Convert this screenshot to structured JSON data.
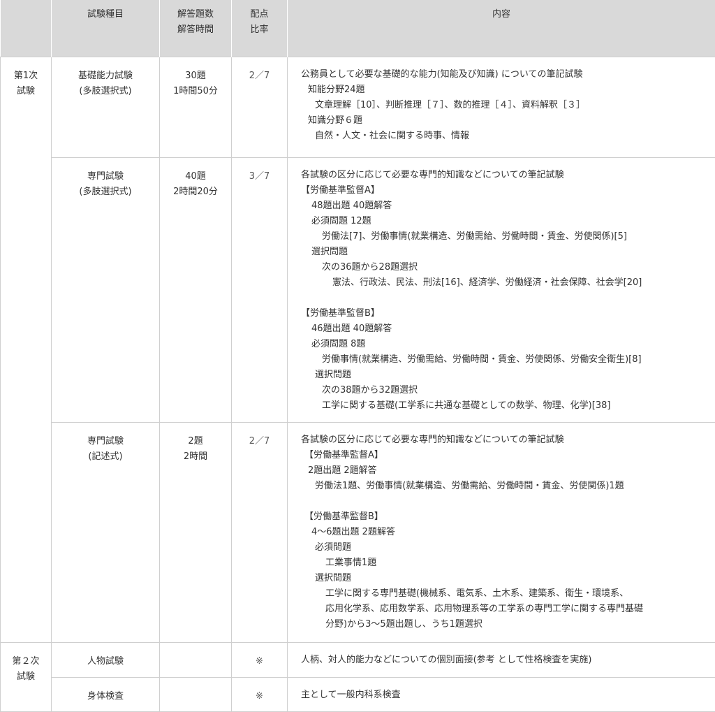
{
  "header": [
    "",
    "試験種目",
    "解答題数\n解答時間",
    "配点\n比率",
    "内容"
  ],
  "rows": [
    {
      "stage": "第1次\n試験",
      "name": "基礎能力試験\n(多肢選択式)",
      "count": "30題\n1時間50分",
      "ratio": "2／7",
      "content": [
        {
          "indent": 0,
          "text": "公務員として必要な基礎的な能力(知能及び知識) についての筆記試験"
        },
        {
          "indent": 1,
          "text": "知能分野24題"
        },
        {
          "indent": 2,
          "text": "文章理解［10］、判断推理［７］、数的推理［４］、資料解釈［３］"
        },
        {
          "indent": 1,
          "text": "知識分野６題"
        },
        {
          "indent": 2,
          "text": "自然・人文・社会に関する時事、情報"
        }
      ]
    },
    {
      "stage": "",
      "name": "専門試験\n(多肢選択式)",
      "count": "40題\n2時間20分",
      "ratio": "3／7",
      "content": [
        {
          "indent": 0,
          "text": "各試験の区分に応じて必要な専門的知識などについての筆記試験"
        },
        {
          "indent": 0,
          "text": "【労働基準監督A】"
        },
        {
          "indent": 1.5,
          "text": "48題出題 40題解答"
        },
        {
          "indent": 1.5,
          "text": "必須問題 12題"
        },
        {
          "indent": 3,
          "text": "労働法[7]、労働事情(就業構造、労働需給、労働時間・賃金、労使関係)[5]"
        },
        {
          "indent": 1.5,
          "text": "選択問題"
        },
        {
          "indent": 3,
          "text": "次の36題から28題選択"
        },
        {
          "indent": 4.5,
          "text": "憲法、行政法、民法、刑法[16]、経済学、労働経済・社会保障、社会学[20]"
        },
        {
          "indent": 0,
          "text": ""
        },
        {
          "indent": 0,
          "text": "【労働基準監督B】"
        },
        {
          "indent": 1.5,
          "text": "46題出題 40題解答"
        },
        {
          "indent": 1.5,
          "text": "必須問題 8題"
        },
        {
          "indent": 3,
          "text": "労働事情(就業構造、労働需給、労働時間・賃金、労使関係、労働安全衛生)[8]"
        },
        {
          "indent": 2,
          "text": "選択問題"
        },
        {
          "indent": 3,
          "text": "次の38題から32題選択"
        },
        {
          "indent": 3,
          "text": "工学に関する基礎(工学系に共通な基礎としての数学、物理、化学)[38]"
        }
      ]
    },
    {
      "stage": "",
      "name": "専門試験\n(記述式)",
      "count": "2題\n2時間",
      "ratio": "2／7",
      "content": [
        {
          "indent": 0,
          "text": "各試験の区分に応じて必要な専門的知識などについての筆記試験"
        },
        {
          "indent": 0.5,
          "text": "【労働基準監督A】"
        },
        {
          "indent": 1,
          "text": "2題出題 2題解答"
        },
        {
          "indent": 2,
          "text": "労働法1題、労働事情(就業構造、労働需給、労働時間・賃金、労使関係)1題"
        },
        {
          "indent": 0,
          "text": ""
        },
        {
          "indent": 0.5,
          "text": "【労働基準監督B】"
        },
        {
          "indent": 1.5,
          "text": "4～6題出題 2題解答"
        },
        {
          "indent": 2,
          "text": "必須問題"
        },
        {
          "indent": 3.5,
          "text": "工業事情1題"
        },
        {
          "indent": 2,
          "text": "選択問題"
        },
        {
          "indent": 3.5,
          "text": "工学に関する専門基礎(機械系、電気系、土木系、建築系、衛生・環境系、"
        },
        {
          "indent": 3.5,
          "text": "応用化学系、応用数学系、応用物理系等の工学系の専門工学に関する専門基礎"
        },
        {
          "indent": 3.5,
          "text": "分野)から3～5題出題し、うち1題選択"
        }
      ]
    },
    {
      "stage": "第２次\n試験",
      "name": "人物試験",
      "count": "",
      "ratio": "※",
      "content": [
        {
          "indent": 0,
          "text": "人柄、対人的能力などについての個別面接(参考 として性格検査を実施)"
        }
      ]
    },
    {
      "stage": "",
      "name": "身体検査",
      "count": "",
      "ratio": "※",
      "content": [
        {
          "indent": 0,
          "text": "主として一般内科系検査"
        }
      ]
    }
  ]
}
